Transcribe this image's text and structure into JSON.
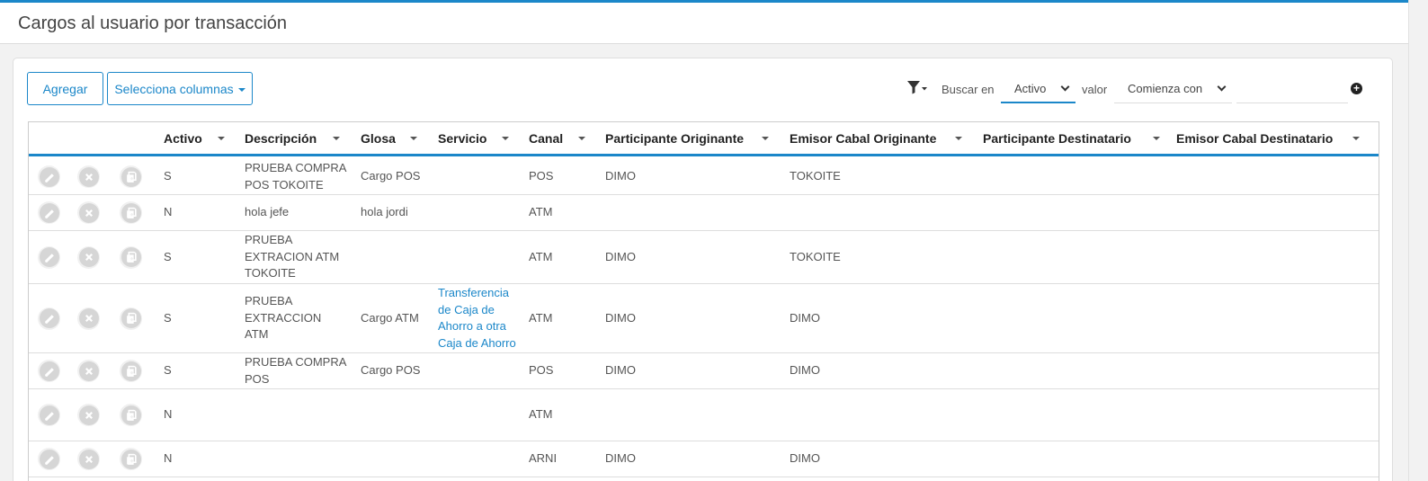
{
  "page": {
    "title": "Cargos al usuario por transacción"
  },
  "toolbar": {
    "add_label": "Agregar",
    "columns_label": "Selecciona columnas",
    "search_in_label": "Buscar en",
    "search_field": "Activo",
    "value_label": "valor",
    "operator": "Comienza con",
    "value": ""
  },
  "columns": [
    "Activo",
    "Descripción",
    "Glosa",
    "Servicio",
    "Canal",
    "Participante Originante",
    "Emisor Cabal Originante",
    "Participante Destinatario",
    "Emisor Cabal Destinatario"
  ],
  "rows": [
    {
      "activo": "S",
      "descripcion": [
        "PRUEBA COMPRA",
        "POS TOKOITE"
      ],
      "glosa": "Cargo POS",
      "servicio": [],
      "canal": "POS",
      "part_orig": "DIMO",
      "emisor_orig": "TOKOITE",
      "part_dest": "",
      "emisor_dest": ""
    },
    {
      "activo": "N",
      "descripcion": [
        "hola jefe"
      ],
      "glosa": "hola jordi",
      "servicio": [],
      "canal": "ATM",
      "part_orig": "",
      "emisor_orig": "",
      "part_dest": "",
      "emisor_dest": ""
    },
    {
      "activo": "S",
      "descripcion": [
        "PRUEBA",
        "EXTRACION ATM",
        "TOKOITE"
      ],
      "glosa": "",
      "servicio": [],
      "canal": "ATM",
      "part_orig": "DIMO",
      "emisor_orig": "TOKOITE",
      "part_dest": "",
      "emisor_dest": ""
    },
    {
      "activo": "S",
      "descripcion": [
        "PRUEBA",
        "EXTRACCION",
        "ATM"
      ],
      "glosa": "Cargo ATM",
      "servicio": [
        "Transferencia",
        "de Caja de",
        "Ahorro a otra",
        "Caja de Ahorro"
      ],
      "canal": "ATM",
      "part_orig": "DIMO",
      "emisor_orig": "DIMO",
      "part_dest": "",
      "emisor_dest": ""
    },
    {
      "activo": "S",
      "descripcion": [
        "PRUEBA COMPRA",
        "POS"
      ],
      "glosa": "Cargo POS",
      "servicio": [],
      "canal": "POS",
      "part_orig": "DIMO",
      "emisor_orig": "DIMO",
      "part_dest": "",
      "emisor_dest": ""
    },
    {
      "activo": "N",
      "descripcion": [],
      "glosa": "",
      "servicio": [],
      "canal": "ATM",
      "part_orig": "",
      "emisor_orig": "",
      "part_dest": "",
      "emisor_dest": ""
    },
    {
      "activo": "N",
      "descripcion": [],
      "glosa": "",
      "servicio": [],
      "canal": "ARNI",
      "part_orig": "DIMO",
      "emisor_orig": "DIMO",
      "part_dest": "",
      "emisor_dest": ""
    }
  ],
  "row_actions": [
    "edit-icon",
    "delete-icon",
    "copy-icon"
  ],
  "colors": {
    "accent": "#1b87c9"
  }
}
